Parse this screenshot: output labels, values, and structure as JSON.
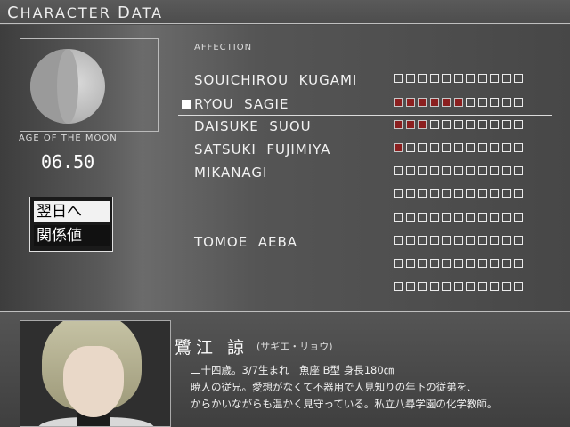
{
  "header": {
    "title_big1": "C",
    "title_rest1": "HARACTER ",
    "title_big2": "D",
    "title_rest2": "ATA"
  },
  "moon": {
    "label": "AGE OF THE MOON",
    "value": "06.50"
  },
  "menu": {
    "next_day": "翌日へ",
    "relations": "関係値"
  },
  "affection": {
    "label": "AFFECTION",
    "total_boxes": 11,
    "rows": [
      {
        "name": "SOUICHIROU  KUGAMI",
        "filled": 0,
        "selected": false
      },
      {
        "name": "RYOU  SAGIE",
        "filled": 6,
        "selected": true
      },
      {
        "name": "DAISUKE  SUOU",
        "filled": 3,
        "selected": false
      },
      {
        "name": "SATSUKI  FUJIMIYA",
        "filled": 1,
        "selected": false
      },
      {
        "name": "MIKANAGI",
        "filled": 0,
        "selected": false
      },
      {
        "name": "",
        "filled": 0,
        "selected": false
      },
      {
        "name": "",
        "filled": 0,
        "selected": false
      },
      {
        "name": "TOMOE  AEBA",
        "filled": 0,
        "selected": false
      },
      {
        "name": "",
        "filled": 0,
        "selected": false
      },
      {
        "name": "",
        "filled": 0,
        "selected": false
      }
    ]
  },
  "profile": {
    "name": "鷺江 諒",
    "reading": "(サギエ・リョウ)",
    "line1": "二十四歳。3/7生まれ　魚座 B型 身長180㎝",
    "line2": "暁人の従兄。愛想がなくて不器用で人見知りの年下の従弟を、",
    "line3": "からかいながらも温かく見守っている。私立八尋学園の化学教師。"
  },
  "colors": {
    "affection_fill": "#8b1f1f",
    "menu_selected_bg": "#f2f2f2"
  }
}
